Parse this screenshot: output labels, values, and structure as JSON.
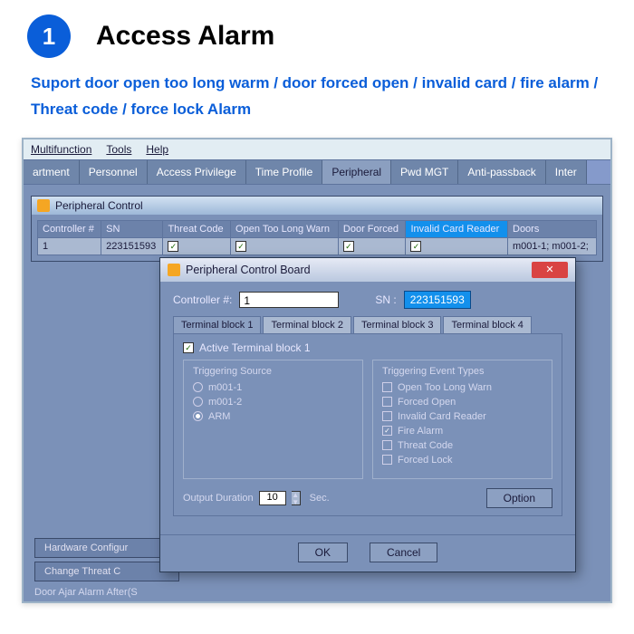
{
  "badge": "1",
  "title": "Access Alarm",
  "subtitle": "Suport door open too long warm / door forced open / invalid card / fire alarm / Threat code / force lock Alarm",
  "menu": [
    "Multifunction",
    "Tools",
    "Help"
  ],
  "tabs": [
    "artment",
    "Personnel",
    "Access Privilege",
    "Time Profile",
    "Peripheral",
    "Pwd MGT",
    "Anti-passback",
    "Inter"
  ],
  "active_tab": 4,
  "child_window_title": "Peripheral Control",
  "table": {
    "headers": [
      "Controller #",
      "SN",
      "Threat Code",
      "Open Too Long Warn",
      "Door Forced",
      "Invalid Card Reader",
      "Doors"
    ],
    "row": {
      "controller": "1",
      "sn": "223151593",
      "doors": "m001-1; m001-2;"
    }
  },
  "dialog": {
    "title": "Peripheral Control Board",
    "controller_label": "Controller #:",
    "controller_val": "1",
    "sn_label": "SN :",
    "sn_val": "223151593",
    "tabs": [
      "Terminal block 1",
      "Terminal block 2",
      "Terminal block 3",
      "Terminal block 4"
    ],
    "active_cb": "Active Terminal block 1",
    "trigger_src": {
      "title": "Triggering Source",
      "opts": [
        "m001-1",
        "m001-2",
        "ARM"
      ],
      "checked": 2
    },
    "event_types": {
      "title": "Triggering Event Types",
      "opts": [
        "Open Too Long Warn",
        "Forced Open",
        "Invalid Card Reader",
        "Fire Alarm",
        "Threat Code",
        "Forced Lock"
      ],
      "checked": [
        3
      ]
    },
    "duration_label": "Output Duration",
    "duration_val": "10",
    "duration_unit": "Sec.",
    "option_btn": "Option",
    "ok": "OK",
    "cancel": "Cancel"
  },
  "bottom_buttons": [
    "Hardware Configur",
    "Change Threat C"
  ],
  "bottom_text": "Door Ajar Alarm After(S"
}
